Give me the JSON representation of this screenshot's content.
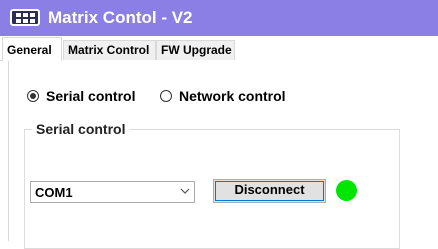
{
  "window": {
    "title": "Matrix Contol - V2",
    "titlebar_color": "#8b7fe6",
    "icon": "matrix-device-icon"
  },
  "tabs": [
    {
      "label": "General",
      "active": true
    },
    {
      "label": "Matrix Control",
      "active": false
    },
    {
      "label": "FW Upgrade",
      "active": false
    }
  ],
  "connection_mode": {
    "options": [
      {
        "label": "Serial control",
        "selected": true
      },
      {
        "label": "Network control",
        "selected": false
      }
    ]
  },
  "serial_group": {
    "title": "Serial control",
    "port_select": {
      "value": "COM1",
      "icon": "chevron-down-icon"
    },
    "disconnect_label": "Disconnect",
    "status": {
      "connected": true,
      "color": "#00e600"
    }
  }
}
